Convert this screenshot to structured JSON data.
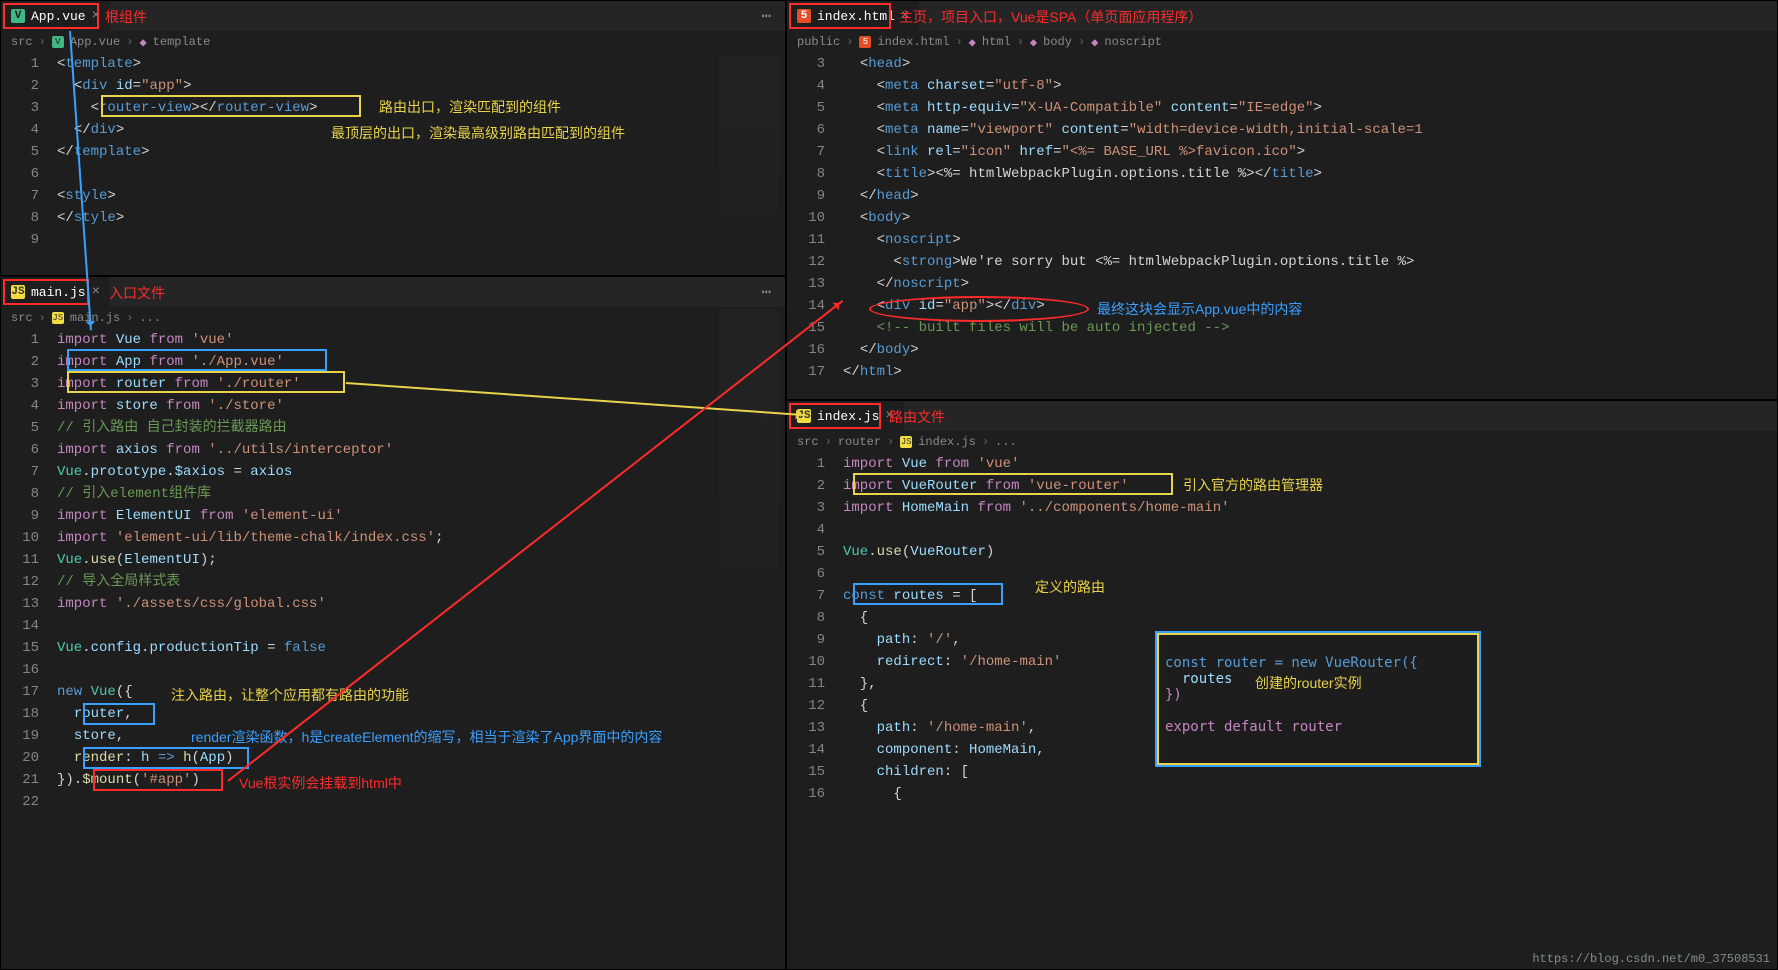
{
  "panes": {
    "topLeft": {
      "tab": {
        "icon": "vue",
        "name": "App.vue"
      },
      "annot_tab": "根组件",
      "breadcrumb": [
        "src",
        "App.vue",
        "template"
      ],
      "lines": [
        {
          "n": 1,
          "html": "<span class='tok-punc'>&lt;</span><span class='tok-tag'>template</span><span class='tok-punc'>&gt;</span>"
        },
        {
          "n": 2,
          "html": "  <span class='tok-punc'>&lt;</span><span class='tok-tag'>div</span> <span class='tok-attr'>id</span>=<span class='tok-str'>\"app\"</span><span class='tok-punc'>&gt;</span>"
        },
        {
          "n": 3,
          "html": "    <span class='tok-punc'>&lt;</span><span class='tok-tag'>router-view</span><span class='tok-punc'>&gt;&lt;/</span><span class='tok-tag'>router-view</span><span class='tok-punc'>&gt;</span>"
        },
        {
          "n": 4,
          "html": "  <span class='tok-punc'>&lt;/</span><span class='tok-tag'>div</span><span class='tok-punc'>&gt;</span>"
        },
        {
          "n": 5,
          "html": "<span class='tok-punc'>&lt;/</span><span class='tok-tag'>template</span><span class='tok-punc'>&gt;</span>"
        },
        {
          "n": 6,
          "html": ""
        },
        {
          "n": 7,
          "html": "<span class='tok-punc'>&lt;</span><span class='tok-tag'>style</span><span class='tok-punc'>&gt;</span>"
        },
        {
          "n": 8,
          "html": "<span class='tok-punc'>&lt;/</span><span class='tok-tag'>style</span><span class='tok-punc'>&gt;</span>"
        },
        {
          "n": 9,
          "html": ""
        }
      ],
      "annot_routerview": "路由出口，渲染匹配到的组件",
      "annot_toproute": "最顶层的出口，渲染最高级别路由匹配到的组件"
    },
    "bottomLeft": {
      "tab": {
        "icon": "js",
        "name": "main.js"
      },
      "annot_tab": "入口文件",
      "breadcrumb": [
        "src",
        "main.js",
        "..."
      ],
      "lines": [
        {
          "n": 1,
          "html": "<span class='tok-kw'>import</span> <span class='tok-var'>Vue</span> <span class='tok-kw'>from</span> <span class='tok-str'>'vue'</span>"
        },
        {
          "n": 2,
          "html": "<span class='tok-kw'>import</span> <span class='tok-var'>App</span> <span class='tok-kw'>from</span> <span class='tok-str'>'./App.vue'</span>"
        },
        {
          "n": 3,
          "html": "<span class='tok-kw'>import</span> <span class='tok-var'>router</span> <span class='tok-kw'>from</span> <span class='tok-str'>'./router'</span>"
        },
        {
          "n": 4,
          "html": "<span class='tok-kw'>import</span> <span class='tok-var'>store</span> <span class='tok-kw'>from</span> <span class='tok-str'>'./store'</span>"
        },
        {
          "n": 5,
          "html": "<span class='tok-cmt'>// 引入路由 自己封装的拦截器路由</span>"
        },
        {
          "n": 6,
          "html": "<span class='tok-kw'>import</span> <span class='tok-var'>axios</span> <span class='tok-kw'>from</span> <span class='tok-str'>'../utils/interceptor'</span>"
        },
        {
          "n": 7,
          "html": "<span class='tok-cls'>Vue</span>.<span class='tok-var'>prototype</span>.<span class='tok-var'>$axios</span> = <span class='tok-var'>axios</span>"
        },
        {
          "n": 8,
          "html": "<span class='tok-cmt'>// 引入element组件库</span>"
        },
        {
          "n": 9,
          "html": "<span class='tok-kw'>import</span> <span class='tok-var'>ElementUI</span> <span class='tok-kw'>from</span> <span class='tok-str'>'element-ui'</span>"
        },
        {
          "n": 10,
          "html": "<span class='tok-kw'>import</span> <span class='tok-str'>'element-ui/lib/theme-chalk/index.css'</span>;"
        },
        {
          "n": 11,
          "html": "<span class='tok-cls'>Vue</span>.<span class='tok-fn'>use</span>(<span class='tok-var'>ElementUI</span>);"
        },
        {
          "n": 12,
          "html": "<span class='tok-cmt'>// 导入全局样式表</span>"
        },
        {
          "n": 13,
          "html": "<span class='tok-kw'>import</span> <span class='tok-str'>'./assets/css/global.css'</span>"
        },
        {
          "n": 14,
          "html": ""
        },
        {
          "n": 15,
          "html": "<span class='tok-cls'>Vue</span>.<span class='tok-var'>config</span>.<span class='tok-var'>productionTip</span> = <span class='tok-const'>false</span>"
        },
        {
          "n": 16,
          "html": ""
        },
        {
          "n": 17,
          "html": "<span class='tok-const'>new</span> <span class='tok-cls'>Vue</span>({"
        },
        {
          "n": 18,
          "html": "  <span class='tok-var'>router</span>,"
        },
        {
          "n": 19,
          "html": "  <span class='tok-var'>store</span>,"
        },
        {
          "n": 20,
          "html": "  <span class='tok-fn'>render</span>: <span class='tok-var'>h</span> <span class='tok-const'>=&gt;</span> <span class='tok-fn'>h</span>(<span class='tok-var'>App</span>)"
        },
        {
          "n": 21,
          "html": "}).<span class='tok-fn'>$mount</span>(<span class='tok-str'>'#app'</span>)"
        },
        {
          "n": 22,
          "html": ""
        }
      ],
      "annot_inject": "注入路由，让整个应用都有路由的功能",
      "annot_render": "render渲染函数，h是createElement的缩写，相当于渲染了App界面中的内容",
      "annot_mount": "Vue根实例会挂载到html中"
    },
    "topRight": {
      "tab": {
        "icon": "html",
        "name": "index.html"
      },
      "annot_tab": "主页，项目入口，Vue是SPA（单页面应用程序）",
      "breadcrumb": [
        "public",
        "index.html",
        "html",
        "body",
        "noscript"
      ],
      "startLine": 3,
      "lines": [
        {
          "n": 3,
          "html": "  <span class='tok-punc'>&lt;</span><span class='tok-tag'>head</span><span class='tok-punc'>&gt;</span>"
        },
        {
          "n": 4,
          "html": "    <span class='tok-punc'>&lt;</span><span class='tok-tag'>meta</span> <span class='tok-attr'>charset</span>=<span class='tok-str'>\"utf-8\"</span><span class='tok-punc'>&gt;</span>"
        },
        {
          "n": 5,
          "html": "    <span class='tok-punc'>&lt;</span><span class='tok-tag'>meta</span> <span class='tok-attr'>http-equiv</span>=<span class='tok-str'>\"X-UA-Compatible\"</span> <span class='tok-attr'>content</span>=<span class='tok-str'>\"IE=edge\"</span><span class='tok-punc'>&gt;</span>"
        },
        {
          "n": 6,
          "html": "    <span class='tok-punc'>&lt;</span><span class='tok-tag'>meta</span> <span class='tok-attr'>name</span>=<span class='tok-str'>\"viewport\"</span> <span class='tok-attr'>content</span>=<span class='tok-str'>\"width=device-width,initial-scale=1</span>"
        },
        {
          "n": 7,
          "html": "    <span class='tok-punc'>&lt;</span><span class='tok-tag'>link</span> <span class='tok-attr'>rel</span>=<span class='tok-str'>\"icon\"</span> <span class='tok-attr'>href</span>=<span class='tok-str'>\"&lt;%= BASE_URL %&gt;favicon.ico\"</span><span class='tok-punc'>&gt;</span>"
        },
        {
          "n": 8,
          "html": "    <span class='tok-punc'>&lt;</span><span class='tok-tag'>title</span><span class='tok-punc'>&gt;</span>&lt;%= htmlWebpackPlugin.options.title %&gt;<span class='tok-punc'>&lt;/</span><span class='tok-tag'>title</span><span class='tok-punc'>&gt;</span>"
        },
        {
          "n": 9,
          "html": "  <span class='tok-punc'>&lt;/</span><span class='tok-tag'>head</span><span class='tok-punc'>&gt;</span>"
        },
        {
          "n": 10,
          "html": "  <span class='tok-punc'>&lt;</span><span class='tok-tag'>body</span><span class='tok-punc'>&gt;</span>"
        },
        {
          "n": 11,
          "html": "    <span class='tok-punc'>&lt;</span><span class='tok-tag'>noscript</span><span class='tok-punc'>&gt;</span>"
        },
        {
          "n": 12,
          "html": "      <span class='tok-punc'>&lt;</span><span class='tok-tag'>strong</span><span class='tok-punc'>&gt;</span>We're sorry but &lt;%= htmlWebpackPlugin.options.title %&gt;"
        },
        {
          "n": 13,
          "html": "    <span class='tok-punc'>&lt;/</span><span class='tok-tag'>noscript</span><span class='tok-punc'>&gt;</span>"
        },
        {
          "n": 14,
          "html": "    <span class='tok-punc'>&lt;</span><span class='tok-tag'>div</span> <span class='tok-attr'>id</span>=<span class='tok-str'>\"app\"</span><span class='tok-punc'>&gt;&lt;/</span><span class='tok-tag'>div</span><span class='tok-punc'>&gt;</span>"
        },
        {
          "n": 15,
          "html": "    <span class='tok-cmt'>&lt;!-- built files will be auto injected --&gt;</span>"
        },
        {
          "n": 16,
          "html": "  <span class='tok-punc'>&lt;/</span><span class='tok-tag'>body</span><span class='tok-punc'>&gt;</span>"
        },
        {
          "n": 17,
          "html": "<span class='tok-punc'>&lt;/</span><span class='tok-tag'>html</span><span class='tok-punc'>&gt;</span>"
        }
      ],
      "annot_divapp": "最终这块会显示App.vue中的内容"
    },
    "bottomRight": {
      "tab": {
        "icon": "js",
        "name": "index.js"
      },
      "annot_tab": "路由文件",
      "breadcrumb": [
        "src",
        "router",
        "index.js",
        "..."
      ],
      "lines": [
        {
          "n": 1,
          "html": "<span class='tok-kw'>import</span> <span class='tok-var'>Vue</span> <span class='tok-kw'>from</span> <span class='tok-str'>'vue'</span>"
        },
        {
          "n": 2,
          "html": "<span class='tok-kw'>import</span> <span class='tok-var'>VueRouter</span> <span class='tok-kw'>from</span> <span class='tok-str'>'vue-router'</span>"
        },
        {
          "n": 3,
          "html": "<span class='tok-kw'>import</span> <span class='tok-var'>HomeMain</span> <span class='tok-kw'>from</span> <span class='tok-str'>'../components/home-main'</span>"
        },
        {
          "n": 4,
          "html": ""
        },
        {
          "n": 5,
          "html": "<span class='tok-cls'>Vue</span>.<span class='tok-fn'>use</span>(<span class='tok-var'>VueRouter</span>)"
        },
        {
          "n": 6,
          "html": ""
        },
        {
          "n": 7,
          "html": "<span class='tok-const'>const</span> <span class='tok-var'>routes</span> = ["
        },
        {
          "n": 8,
          "html": "  {"
        },
        {
          "n": 9,
          "html": "    <span class='tok-var'>path</span>: <span class='tok-str'>'/'</span>,"
        },
        {
          "n": 10,
          "html": "    <span class='tok-var'>redirect</span>: <span class='tok-str'>'/home-main'</span>"
        },
        {
          "n": 11,
          "html": "  },"
        },
        {
          "n": 12,
          "html": "  {"
        },
        {
          "n": 13,
          "html": "    <span class='tok-var'>path</span>: <span class='tok-str'>'/home-main'</span>,"
        },
        {
          "n": 14,
          "html": "    <span class='tok-var'>component</span>: <span class='tok-var'>HomeMain</span>,"
        },
        {
          "n": 15,
          "html": "    <span class='tok-var'>children</span>: ["
        },
        {
          "n": 16,
          "html": "      {"
        }
      ],
      "annot_import": "引入官方的路由管理器",
      "annot_routes": "定义的路由",
      "sidebox": {
        "l1": "const router = new VueRouter({",
        "l2": "  routes",
        "l3": "})",
        "l4": "",
        "l5": "export default router",
        "label": "创建的router实例"
      }
    }
  },
  "watermark": "https://blog.csdn.net/m0_37508531"
}
